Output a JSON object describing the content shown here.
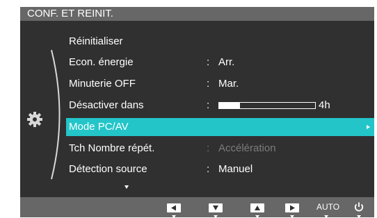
{
  "osd": {
    "title": "CONF. ET REINIT.",
    "menu_items": [
      {
        "label": "Réinitialiser",
        "value": ""
      },
      {
        "label": "Econ. énergie",
        "value": "Arr."
      },
      {
        "label": "Minuterie OFF",
        "value": "Mar."
      },
      {
        "label": "Désactiver dans",
        "value": "4h",
        "bar_fraction": 0.22
      },
      {
        "label": "Mode PC/AV",
        "value": "",
        "selected": true
      },
      {
        "label": "Tch Nombre répét.",
        "value": "Accélération",
        "disabled": true
      },
      {
        "label": "Détection source",
        "value": "Manuel"
      }
    ],
    "separator": ":",
    "colors": {
      "highlight": "#23c5c9",
      "panel": "#303030",
      "title_bar": "#676767",
      "disabled_text": "#7c7c7c"
    }
  },
  "bottom_bar": {
    "buttons": [
      {
        "name": "left-key",
        "icon": "left-triangle-icon"
      },
      {
        "name": "down-key",
        "icon": "down-triangle-icon"
      },
      {
        "name": "up-key",
        "icon": "up-triangle-icon"
      },
      {
        "name": "enter-key",
        "icon": "right-triangle-icon"
      }
    ],
    "auto_label": "AUTO",
    "power_icon": "power-icon"
  }
}
